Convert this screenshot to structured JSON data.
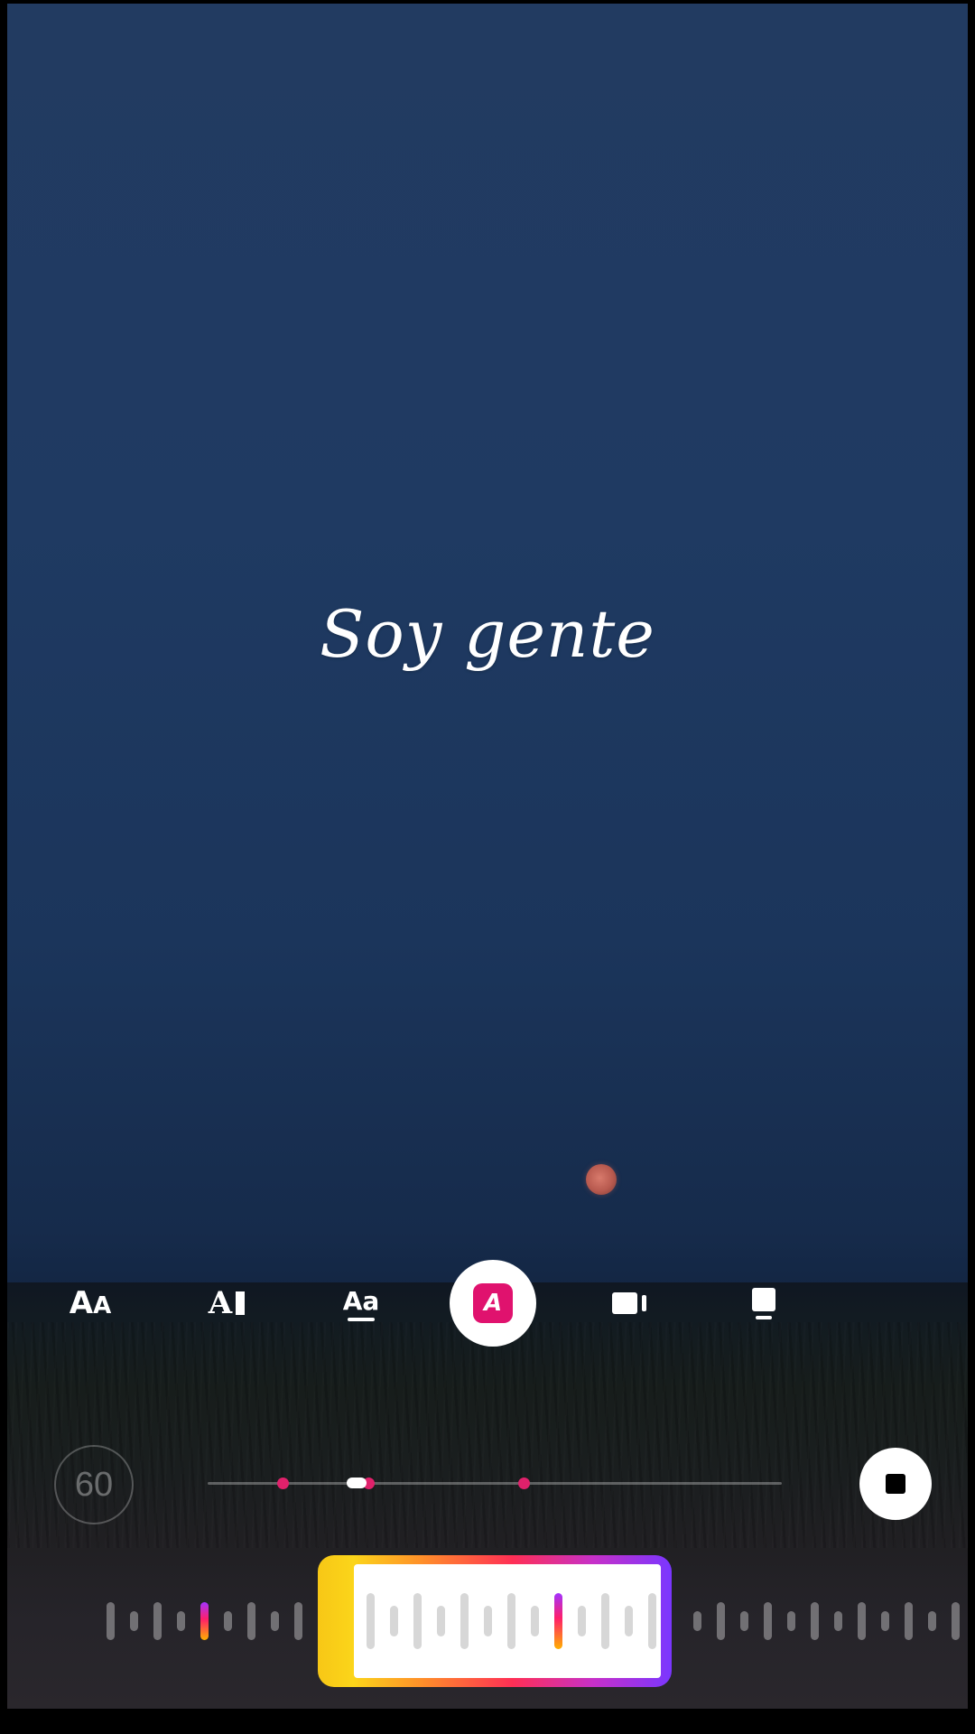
{
  "caption": {
    "text": "Soy gente"
  },
  "toolbar": {
    "items": [
      {
        "name": "text-size",
        "label": "AA",
        "selected": false
      },
      {
        "name": "text-background",
        "label": "A",
        "selected": false
      },
      {
        "name": "text-underline",
        "label": "Aa",
        "selected": false
      },
      {
        "name": "animation",
        "label": "A",
        "selected": true
      },
      {
        "name": "align-left",
        "label": "",
        "selected": false
      },
      {
        "name": "align-top",
        "label": "",
        "selected": false
      }
    ],
    "selected_color": "#e0126e"
  },
  "timer": {
    "value": "60"
  },
  "timeline": {
    "thumb_position": 0.26,
    "markers": [
      0.13,
      0.28,
      0.55
    ],
    "marker_color": "#e0216b"
  },
  "clip_frame": {
    "gradient_colors": [
      "#f7c716",
      "#ff2f55",
      "#7a36ff"
    ]
  }
}
